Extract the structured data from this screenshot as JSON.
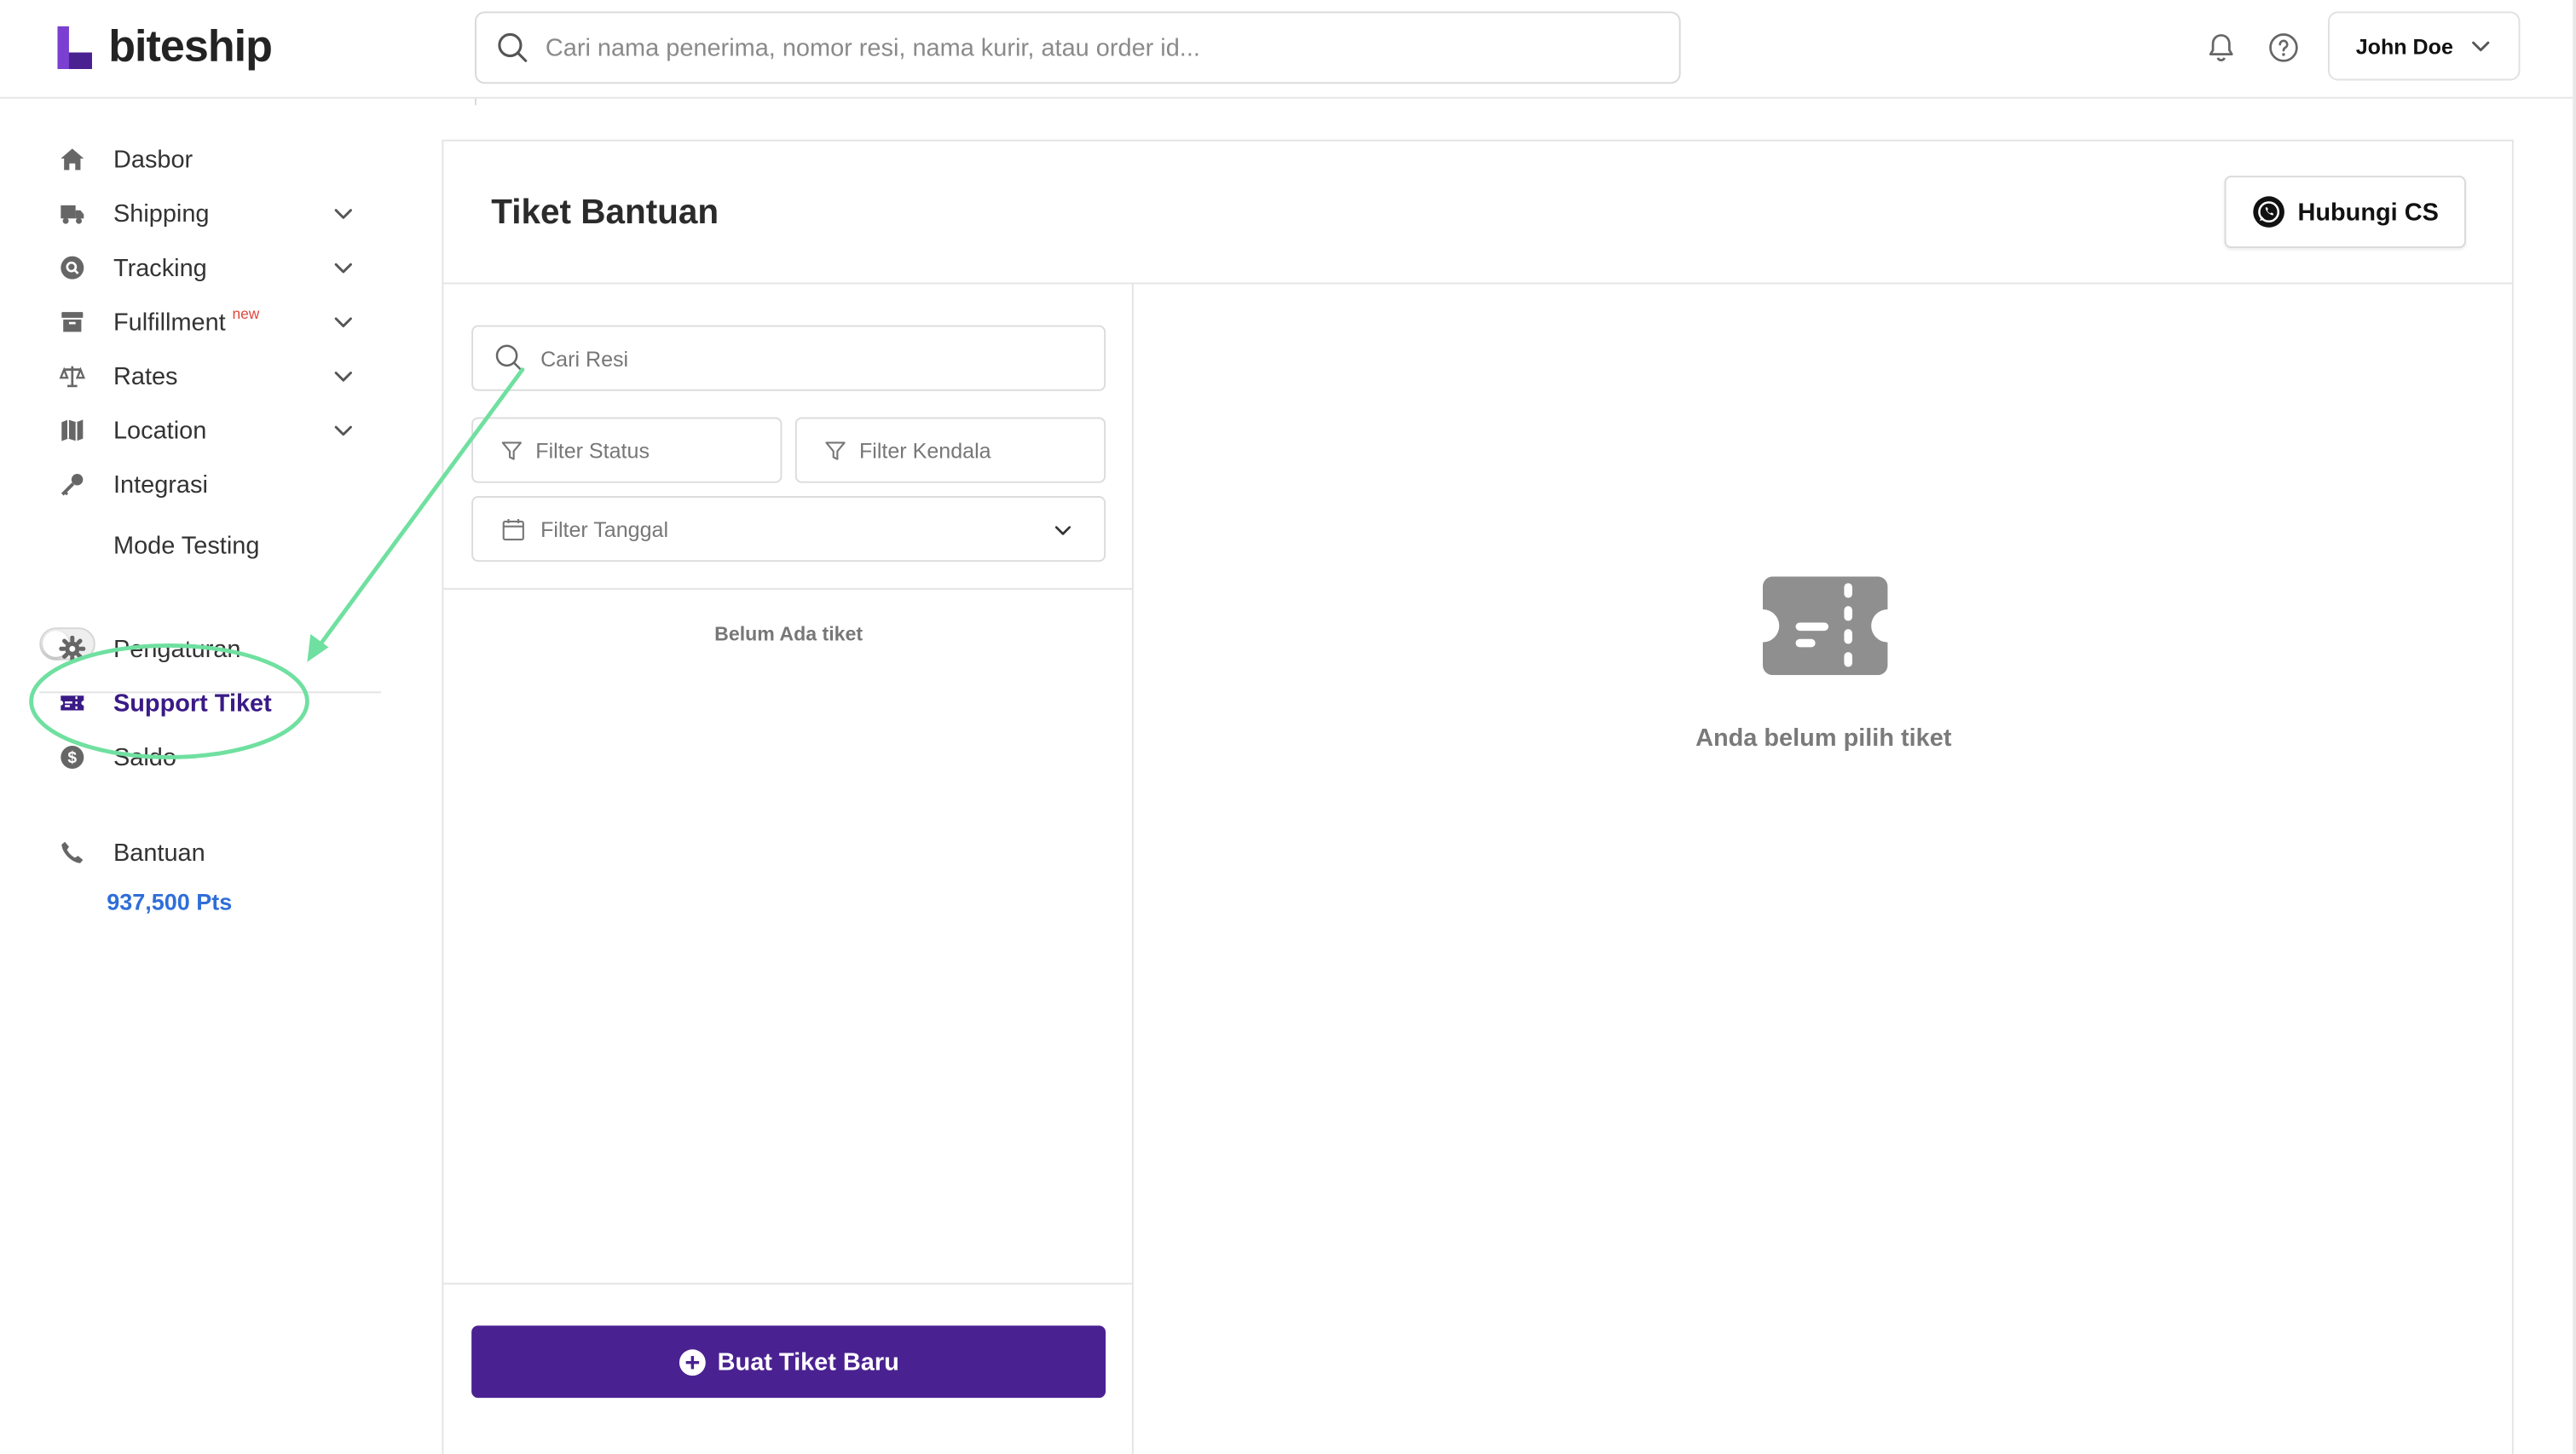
{
  "brand": {
    "name": "biteship",
    "accent": "#4a2191",
    "logo_purple": "#7b3fd1"
  },
  "header": {
    "search_placeholder": "Cari nama penerima, nomor resi, nama kurir, atau order id...",
    "user_name": "John Doe",
    "icons": [
      "bell-icon",
      "help-circle-icon",
      "chevron-down-icon"
    ]
  },
  "sidebar": {
    "items": [
      {
        "label": "Dasbor",
        "icon": "home-icon"
      },
      {
        "label": "Shipping",
        "icon": "truck-icon"
      },
      {
        "label": "Tracking",
        "icon": "search-circle-icon"
      },
      {
        "label": "Fulfillment",
        "icon": "archive-box-icon",
        "badge": "new"
      },
      {
        "label": "Rates",
        "icon": "scale-icon"
      },
      {
        "label": "Location",
        "icon": "map-icon"
      },
      {
        "label": "Integrasi",
        "icon": "key-icon"
      },
      {
        "label": "Mode Testing",
        "icon": "toggle-icon"
      },
      {
        "label": "Pengaturan",
        "icon": "gear-icon"
      },
      {
        "label": "Support Tiket",
        "icon": "ticket-icon"
      },
      {
        "label": "Saldo",
        "icon": "dollar-circle-icon",
        "value": "937,500 Pts"
      },
      {
        "label": "Bantuan",
        "icon": "phone-icon"
      }
    ],
    "active": "Support Tiket",
    "mode_testing_on": false
  },
  "main": {
    "title": "Tiket Bantuan",
    "hubungi_label": "Hubungi CS",
    "search_resi_placeholder": "Cari Resi",
    "filter_status": "Filter Status",
    "filter_kendala": "Filter Kendala",
    "filter_tanggal": "Filter Tanggal",
    "empty_list": "Belum Ada tiket",
    "create_label": "Buat Tiket Baru",
    "empty_detail": "Anda belum pilih tiket"
  },
  "annotation_color": "#6fe0a0"
}
